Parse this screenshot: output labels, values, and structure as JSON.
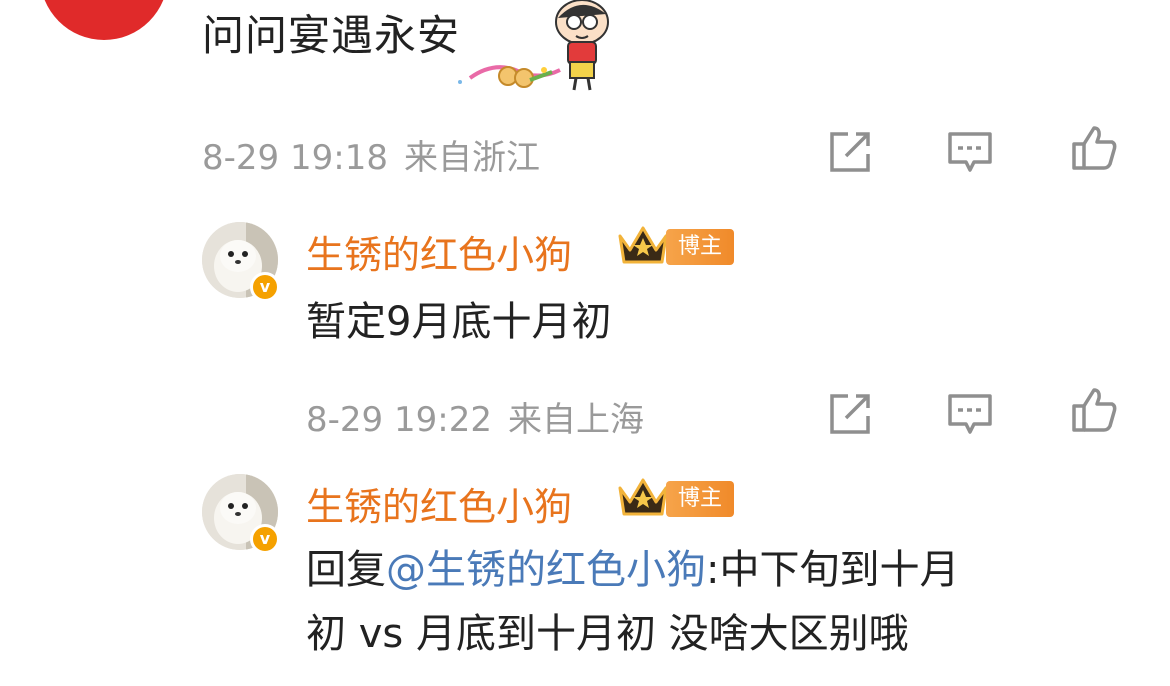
{
  "comment0": {
    "text": "问问宴遇永安",
    "time": "8-29 19:18",
    "location": "来自浙江"
  },
  "reply1": {
    "author": "生锈的红色小狗",
    "badge": "博主",
    "text": "暂定9月底十月初",
    "time": "8-29 19:22",
    "location": "来自上海"
  },
  "reply2": {
    "author": "生锈的红色小狗",
    "badge": "博主",
    "prefix": "回复",
    "mention": "@生锈的红色小狗",
    "line1_rest": ":中下旬到十月",
    "line2": "初 vs 月底到十月初 没啥大区别哦"
  },
  "icons": {
    "share": "share-icon",
    "comment": "comment-icon",
    "like": "like-icon",
    "crown": "crown-icon",
    "verified": "verified-badge"
  },
  "colors": {
    "author": "#e8741d",
    "mention": "#4a7ab8",
    "meta": "#9a9a9a",
    "badge": "#f08a2a"
  }
}
